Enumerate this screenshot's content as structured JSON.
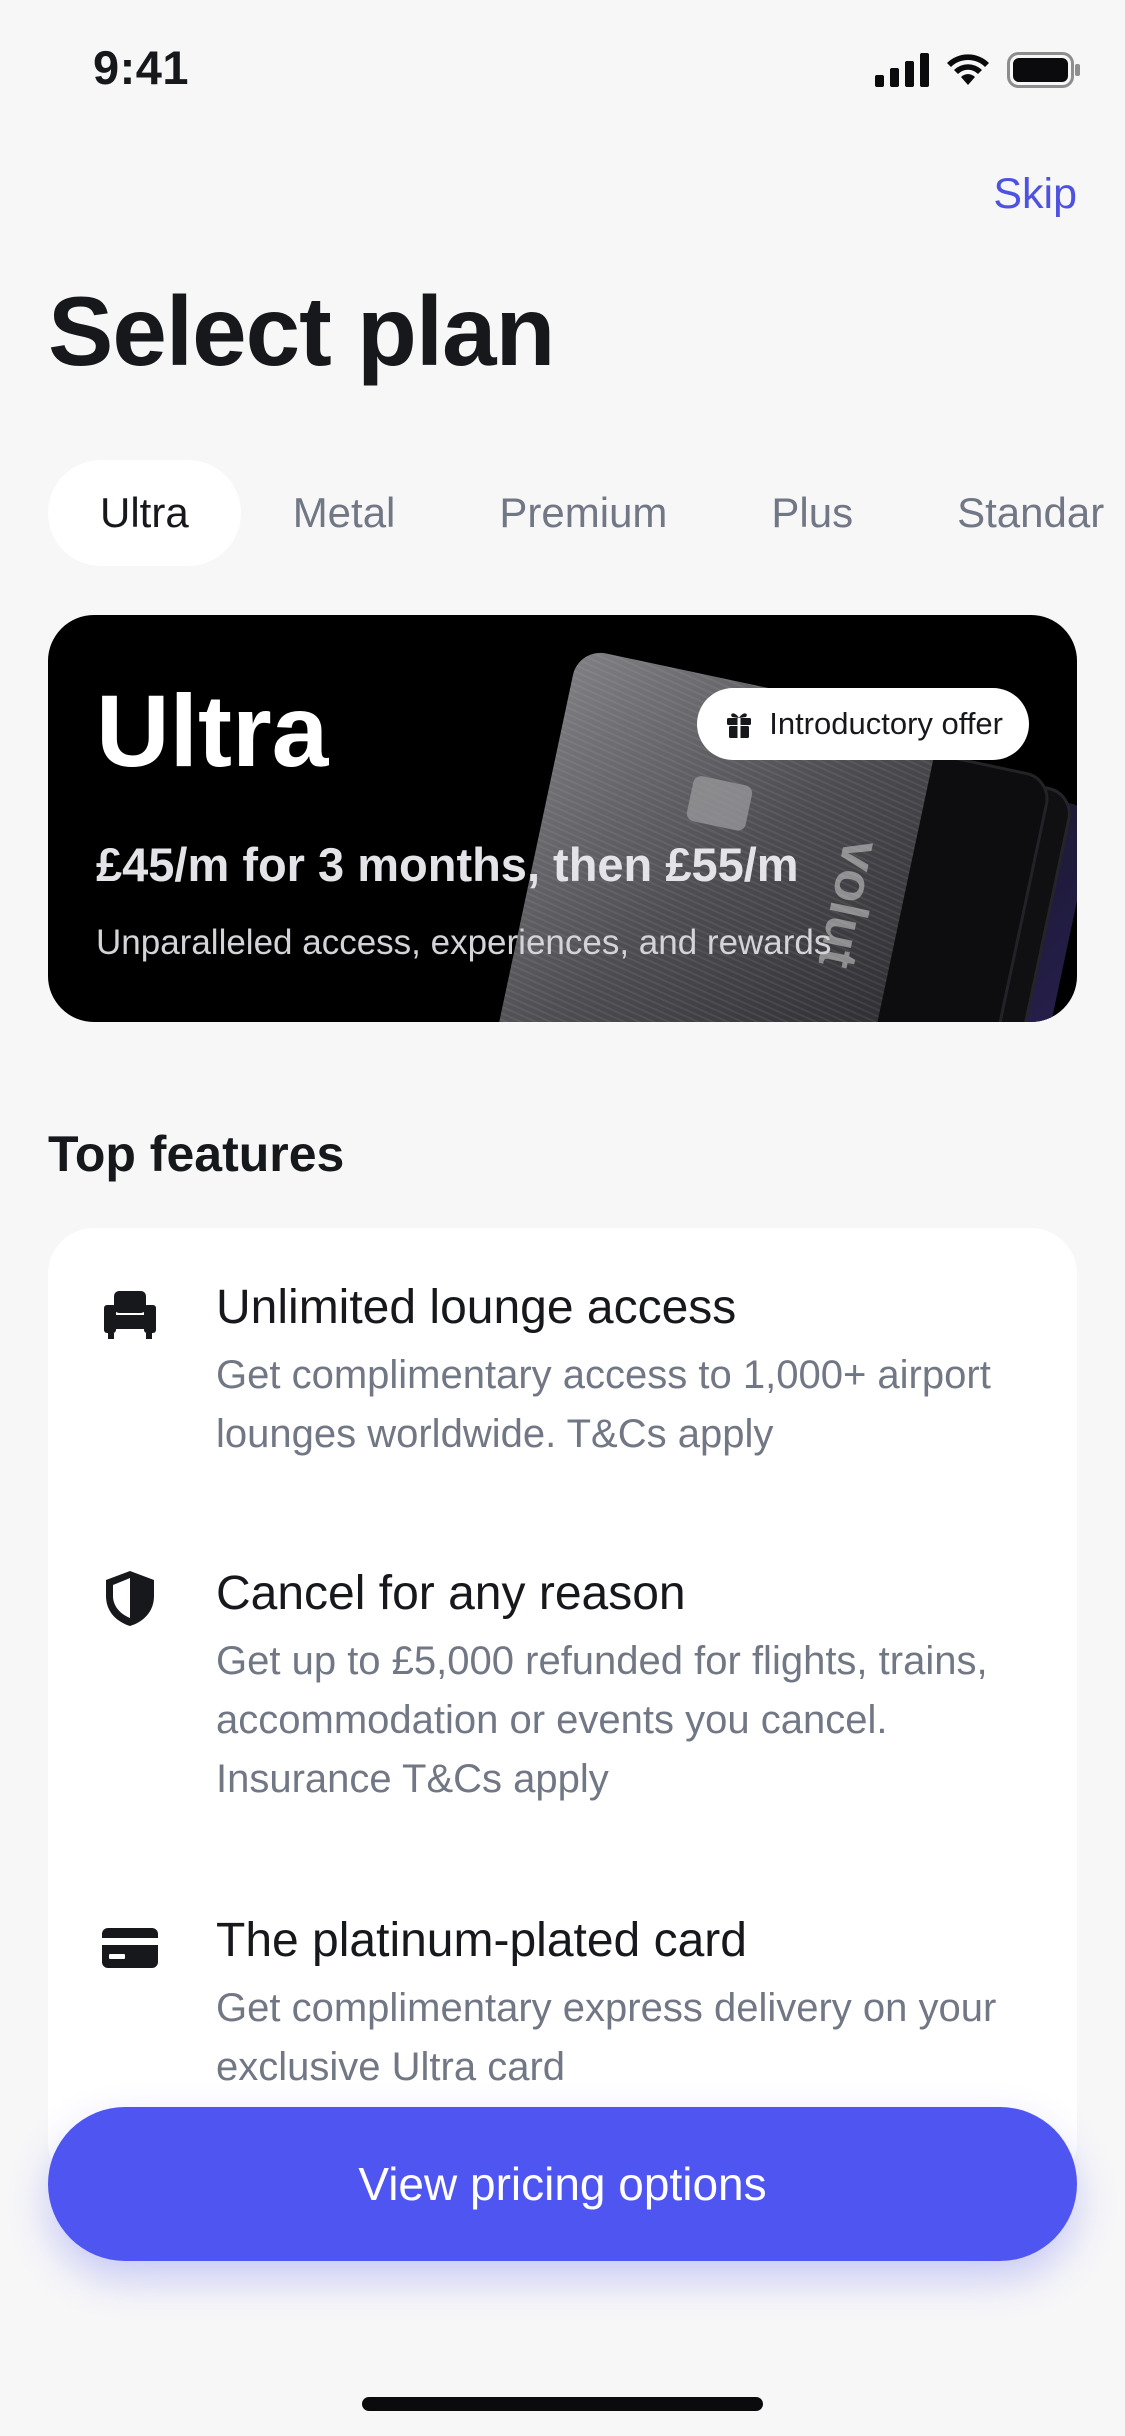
{
  "status_bar": {
    "time": "9:41"
  },
  "header": {
    "skip_label": "Skip",
    "title": "Select plan"
  },
  "tabs": [
    {
      "label": "Ultra",
      "active": true
    },
    {
      "label": "Metal",
      "active": false
    },
    {
      "label": "Premium",
      "active": false
    },
    {
      "label": "Plus",
      "active": false
    },
    {
      "label": "Standar",
      "active": false
    }
  ],
  "plan": {
    "name": "Ultra",
    "badge": "Introductory offer",
    "badge_icon": "gift-icon",
    "price": "£45/m for 3 months, then £55/m",
    "description": "Unparalleled access, experiences, and rewards"
  },
  "features_section": {
    "title": "Top features",
    "items": [
      {
        "icon": "armchair-icon",
        "title": "Unlimited lounge access",
        "description": "Get complimentary access to 1,000+ airport lounges worldwide. T&Cs apply"
      },
      {
        "icon": "shield-icon",
        "title": "Cancel for any reason",
        "description": "Get up to £5,000 refunded for flights, trains, accommodation or events you cancel. Insurance T&Cs apply"
      },
      {
        "icon": "card-icon",
        "title": "The platinum-plated card",
        "description": "Get complimentary express delivery on your exclusive Ultra card"
      }
    ]
  },
  "cta": {
    "label": "View pricing options"
  },
  "colors": {
    "accent": "#4f55f1",
    "link": "#4d53e0",
    "background": "#f7f7f8",
    "card": "#000000"
  }
}
